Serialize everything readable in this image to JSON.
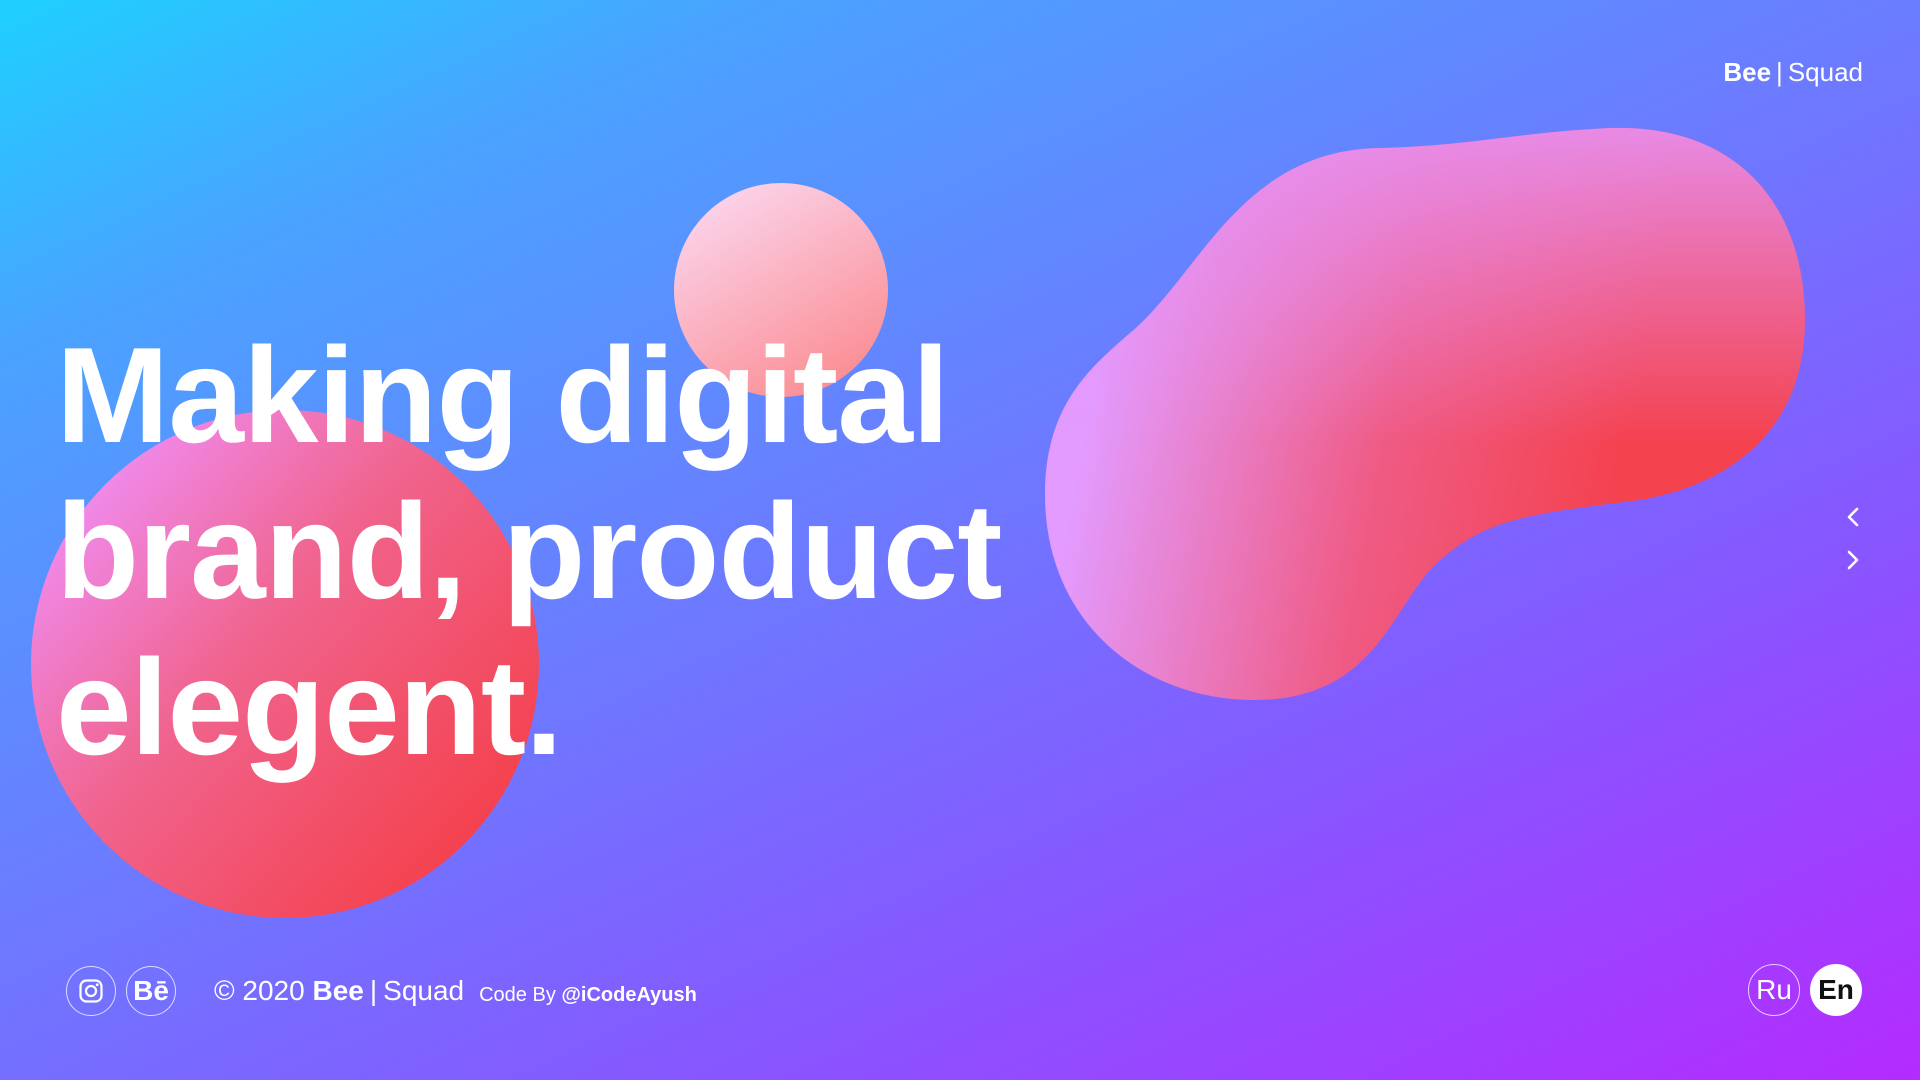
{
  "header": {
    "brand_strong": "Bee",
    "brand_sep": "|",
    "brand_light": "Squad"
  },
  "hero": {
    "lines": [
      "Making digital",
      "brand, product",
      "elegent."
    ]
  },
  "slider": {
    "prev_icon": "chevron-left-icon",
    "next_icon": "chevron-right-icon"
  },
  "footer": {
    "social": [
      {
        "icon": "instagram-icon"
      },
      {
        "icon": "behance-icon",
        "text": "Bē"
      }
    ],
    "copyright_prefix": "© 2020",
    "brand_strong": "Bee",
    "brand_sep": "|",
    "brand_light": "Squad",
    "credit_prefix": "Code By",
    "credit_handle": "@iCodeAyush"
  },
  "languages": {
    "options": [
      "Ru",
      "En"
    ],
    "selected": "En"
  },
  "colors": {
    "background_start": "#1ed0ff",
    "background_end": "#b42bff",
    "blob_pink": "#e99bff",
    "blob_red": "#f4424f",
    "text": "#ffffff"
  }
}
